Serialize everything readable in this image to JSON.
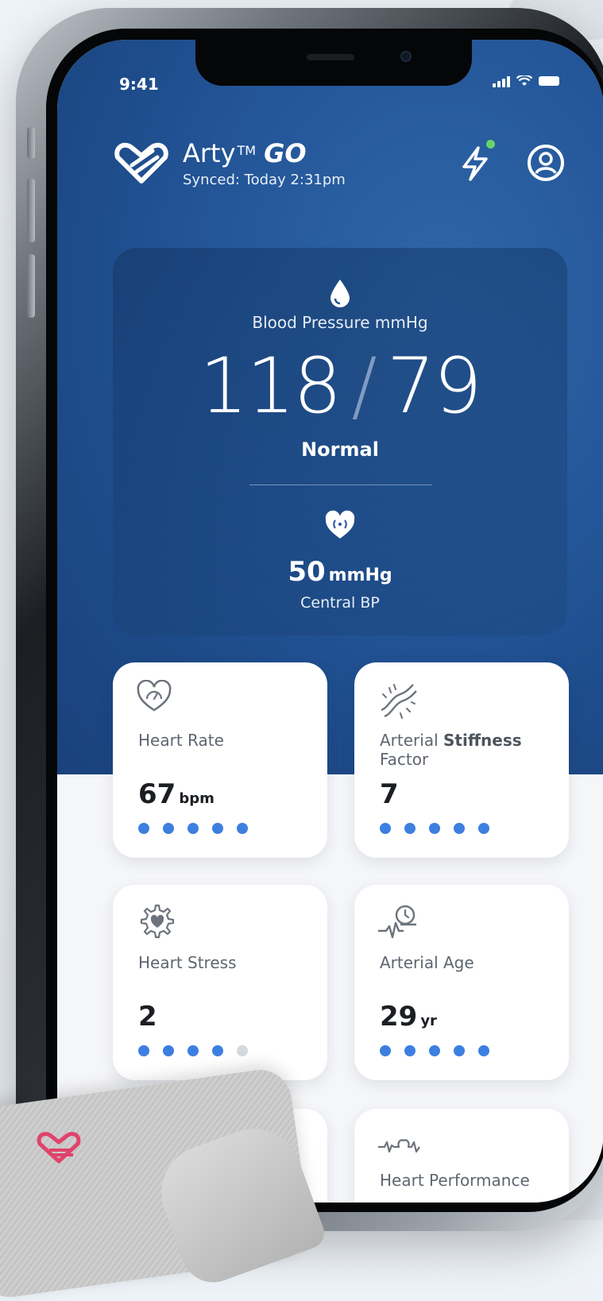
{
  "status_bar": {
    "time": "9:41"
  },
  "header": {
    "app_name": "Arty",
    "trademark": "TM",
    "app_suffix": "GO",
    "synced": "Synced: Today 2:31pm"
  },
  "blood_pressure": {
    "label": "Blood Pressure mmHg",
    "systolic": "118",
    "separator": "/",
    "diastolic": "79",
    "status": "Normal",
    "central_value": "50",
    "central_unit": "mmHg",
    "central_label": "Central BP"
  },
  "metrics": [
    {
      "name": "Heart Rate",
      "value": "67",
      "unit": "bpm",
      "level": 5,
      "max": 5
    },
    {
      "name_part1": "Arterial ",
      "name_part2": "Stiffness",
      "name_part3": "Factor",
      "value": "7",
      "unit": "",
      "level": 5,
      "max": 5
    },
    {
      "name": "Heart Stress",
      "value": "2",
      "unit": "",
      "level": 4,
      "max": 5
    },
    {
      "name": "Arterial Age",
      "value": "29",
      "unit": "yr",
      "level": 5,
      "max": 5
    },
    {
      "name": "",
      "value": "",
      "unit": ""
    },
    {
      "name": "Heart Performance",
      "value": "",
      "unit": ""
    }
  ],
  "colors": {
    "accent": "#3d7fe0",
    "dot_off": "#d6d9de",
    "header_blue": "#24579a",
    "online_dot": "#6ad36b",
    "cuff_logo": "#e0436b"
  }
}
